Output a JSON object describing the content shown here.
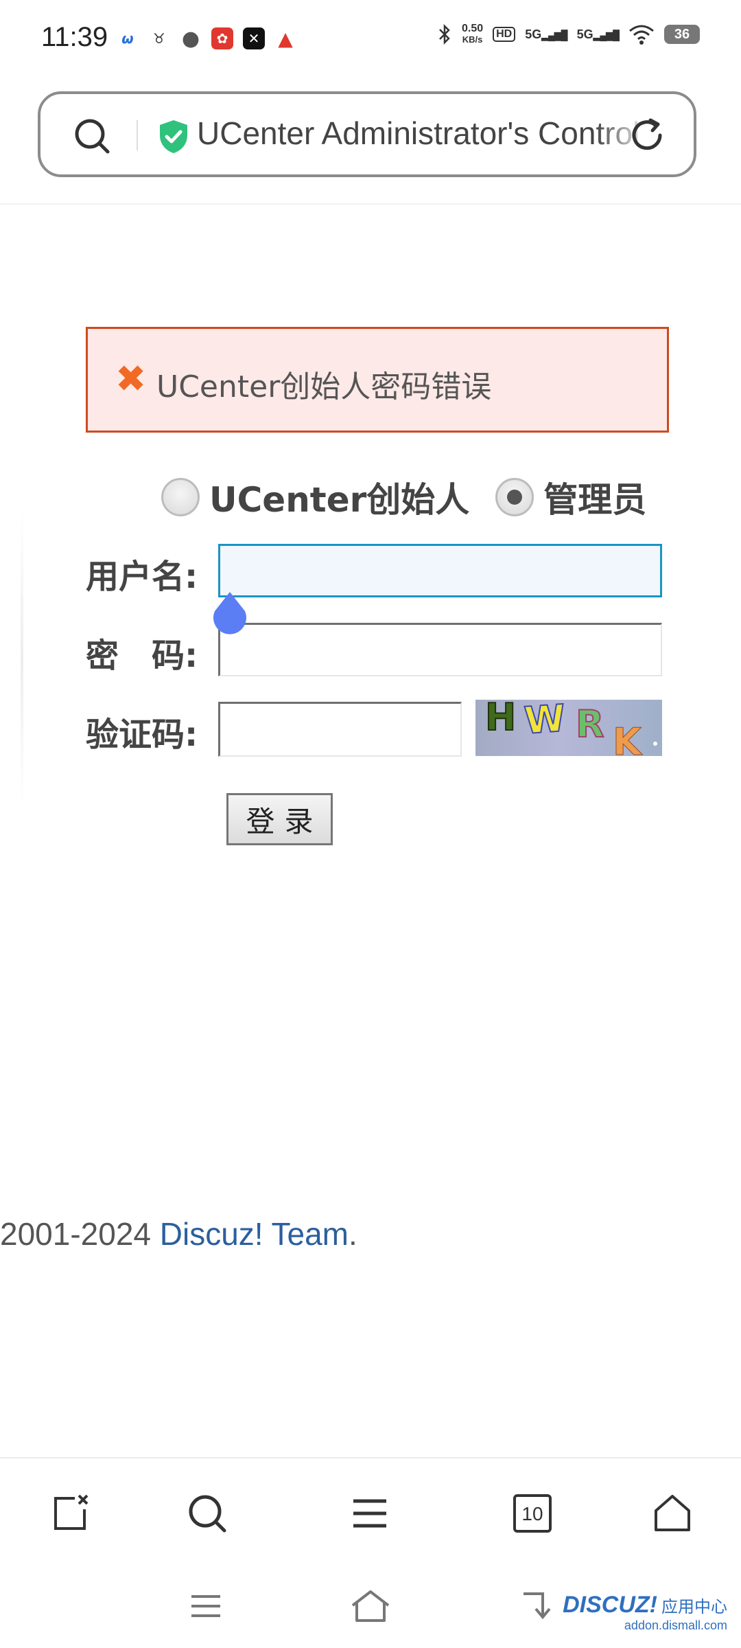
{
  "status_bar": {
    "time": "11:39",
    "net_speed_value": "0.50",
    "net_speed_unit": "KB/s",
    "hd_label": "HD",
    "sim1_label": "5G",
    "sim2_label": "5G",
    "battery_level": "36"
  },
  "address_bar": {
    "title": "UCenter Administrator's Control Panel"
  },
  "login": {
    "error_message": "UCenter创始人密码错误",
    "roles": [
      {
        "label": "UCenter创始人",
        "checked": false
      },
      {
        "label": "管理员",
        "checked": true
      }
    ],
    "username_label": "用户名:",
    "username_value": "",
    "password_label": "密　码:",
    "password_value": "",
    "captcha_label": "验证码:",
    "captcha_value": "",
    "captcha_text": "HWRK",
    "submit_label": "登录"
  },
  "footer": {
    "years": "2001-2024 ",
    "link_text": "Discuz! Team",
    "suffix": "."
  },
  "toolbar": {
    "tabs_count": "10"
  },
  "watermark": {
    "brand": "DISCUZ!",
    "cn": "应用中心",
    "domain": "addon.dismall.com"
  },
  "colors": {
    "error_border": "#cf4a1f",
    "error_bg": "#fde9e7",
    "focus_border": "#1a94c4",
    "link": "#2b5f9e",
    "cursor_drop": "#5b7ef5",
    "shield": "#2fc27c"
  }
}
